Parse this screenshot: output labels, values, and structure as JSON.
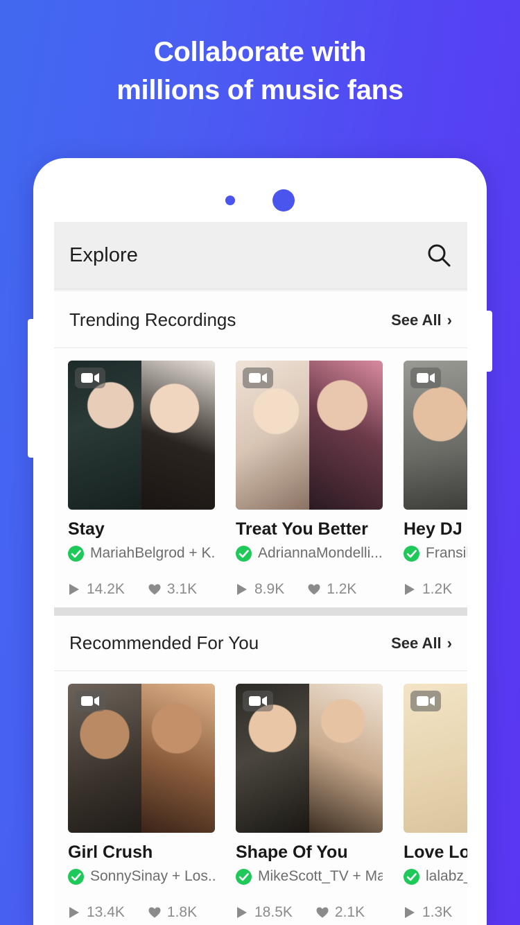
{
  "headline": {
    "line1": "Collaborate with",
    "line2": "millions of music fans"
  },
  "colors": {
    "bg_start": "#4169f0",
    "bg_end": "#5b36f2",
    "sensor_dot": "#4a55ee",
    "verified_green": "#1ec95a",
    "appbar_bg": "#efefef",
    "divider": "#dedede"
  },
  "phone": {
    "sensor_small": "camera-dot",
    "sensor_large": "speaker-dot"
  },
  "app": {
    "appbar": {
      "title": "Explore",
      "search_icon": "search-icon"
    },
    "sections": [
      {
        "title": "Trending Recordings",
        "see_all_label": "See All",
        "see_all_chevron": "›",
        "cards": [
          {
            "title": "Stay",
            "user": "MariahBelgrod + K...",
            "verified": true,
            "plays": "14.2K",
            "likes": "3.1K",
            "video_badge": "video-camera-icon"
          },
          {
            "title": "Treat You Better",
            "user": "AdriannaMondelli...",
            "verified": true,
            "plays": "8.9K",
            "likes": "1.2K",
            "video_badge": "video-camera-icon"
          },
          {
            "title": "Hey DJ",
            "user": "Fransil…",
            "verified": true,
            "plays": "1.2K",
            "likes": "",
            "video_badge": "video-camera-icon"
          }
        ]
      },
      {
        "title": "Recommended For You",
        "see_all_label": "See All",
        "see_all_chevron": "›",
        "cards": [
          {
            "title": "Girl Crush",
            "user": "SonnySinay + Los...",
            "verified": true,
            "plays": "13.4K",
            "likes": "1.8K",
            "video_badge": "video-camera-icon"
          },
          {
            "title": "Shape Of You",
            "user": "MikeScott_TV + Ma...",
            "verified": true,
            "plays": "18.5K",
            "likes": "2.1K",
            "video_badge": "video-camera-icon"
          },
          {
            "title": "Love Lov",
            "user": "lalabz_",
            "verified": true,
            "plays": "1.3K",
            "likes": "",
            "video_badge": "video-camera-icon"
          }
        ]
      }
    ]
  }
}
